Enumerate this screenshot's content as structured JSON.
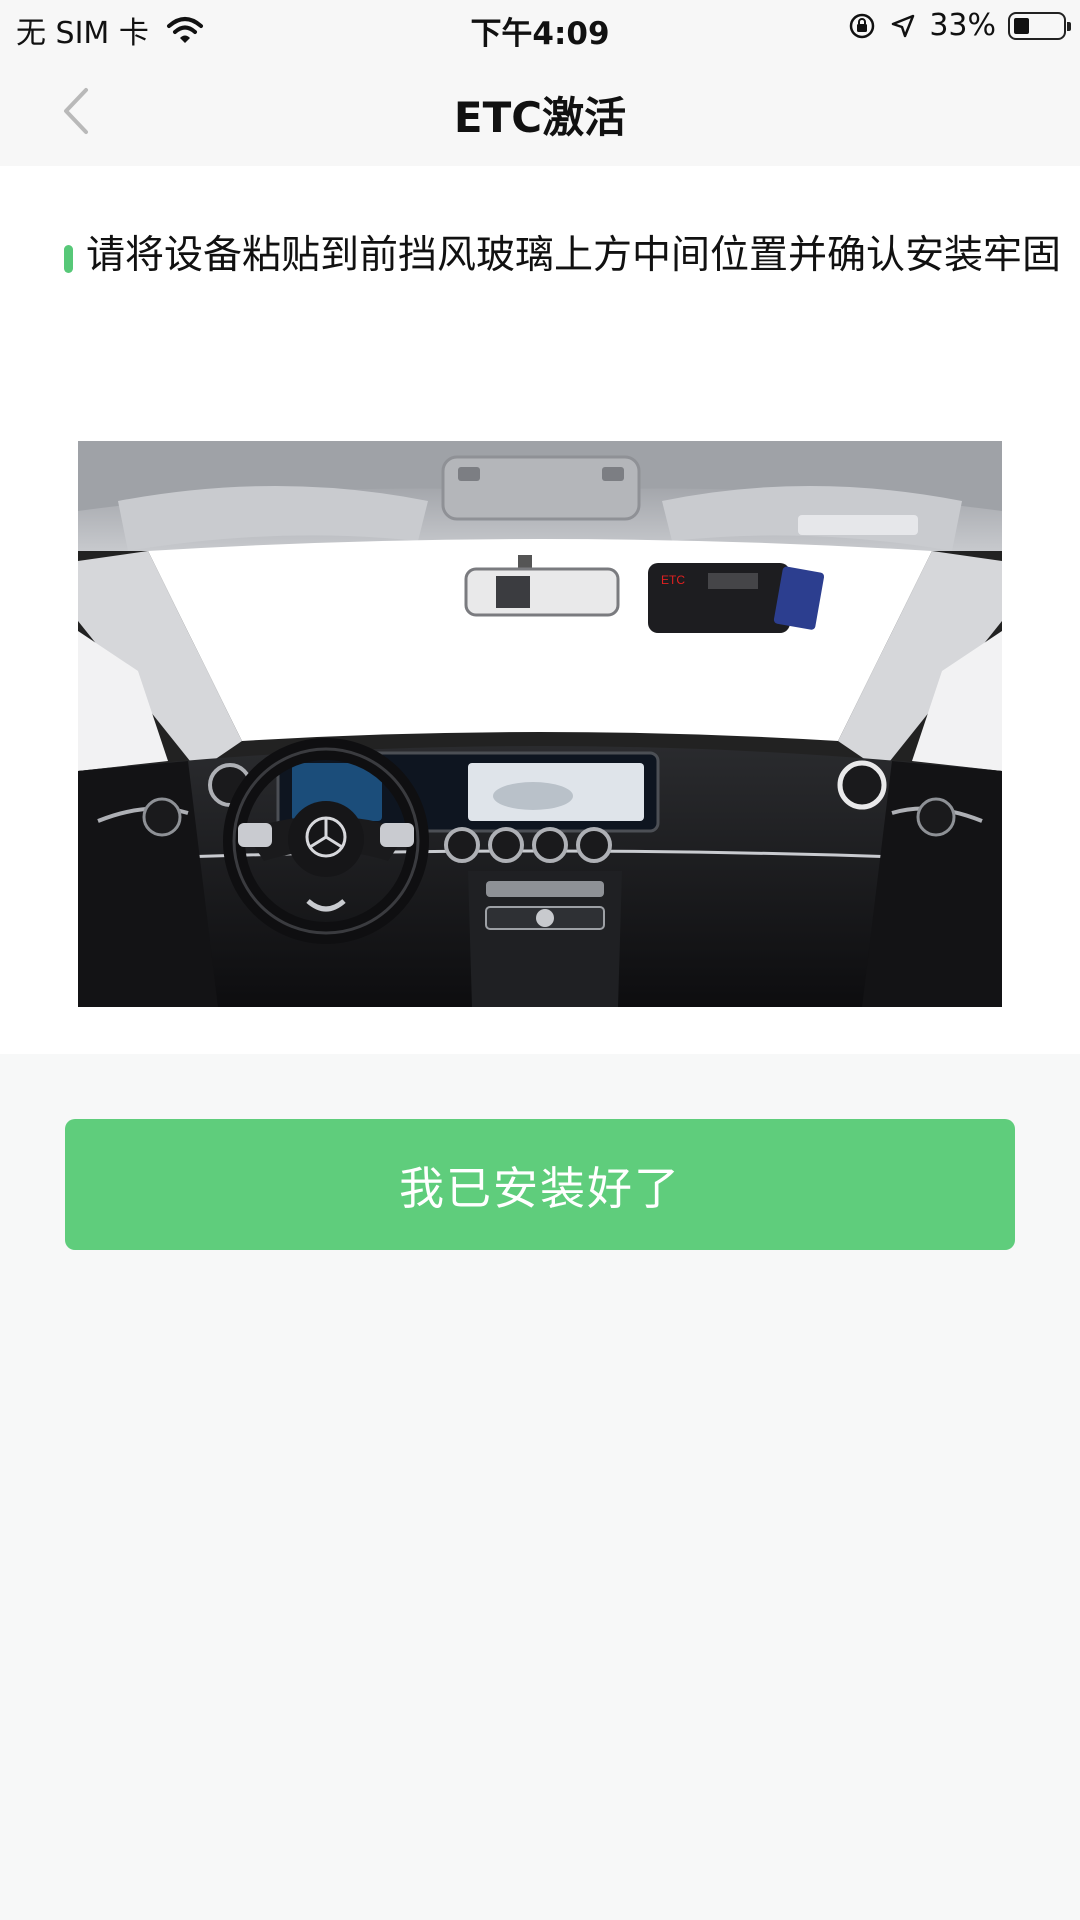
{
  "status_bar": {
    "carrier": "无 SIM 卡",
    "time": "下午4:09",
    "battery_percent_label": "33%",
    "battery_level": 0.33,
    "icons": [
      "wifi-icon",
      "orientation-lock-icon",
      "location-arrow-icon",
      "battery-icon"
    ]
  },
  "nav": {
    "title": "ETC激活",
    "back_icon": "chevron-left-icon"
  },
  "step": {
    "instruction": "请将设备粘贴到前挡风玻璃上方中间位置并确认安装牢固"
  },
  "illustration": {
    "subject": "car-interior-windshield-photo",
    "device_label": "ETC"
  },
  "actions": {
    "confirm_label": "我已安装好了"
  },
  "colors": {
    "accent": "#5fcd7c",
    "step_marker": "#57c878",
    "background": "#f7f8f8"
  }
}
